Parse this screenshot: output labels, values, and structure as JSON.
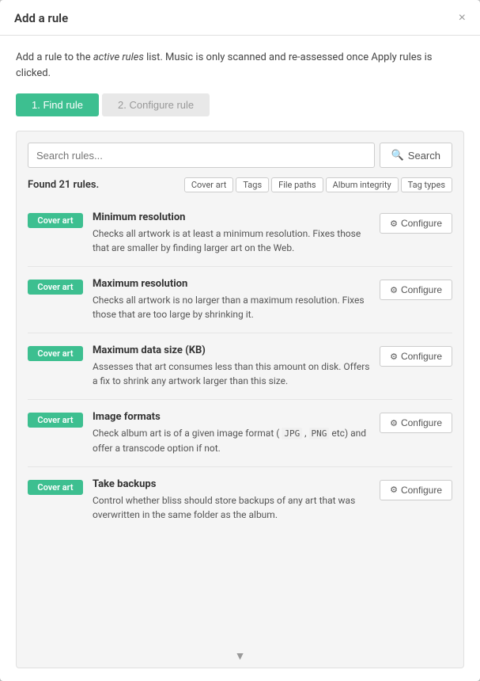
{
  "modal": {
    "title": "Add a rule",
    "close_label": "×",
    "intro": "Add a rule to the ",
    "intro_em": "active rules",
    "intro_suffix": " list. Music is only scanned and re-assessed once Apply rules is clicked.",
    "step1_label": "1. Find rule",
    "step2_label": "2. Configure rule"
  },
  "search": {
    "placeholder": "Search rules...",
    "button_label": "Search",
    "found_text": "Found 21 rules."
  },
  "filters": [
    {
      "label": "Cover art"
    },
    {
      "label": "Tags"
    },
    {
      "label": "File paths"
    },
    {
      "label": "Album integrity"
    },
    {
      "label": "Tag types"
    }
  ],
  "rules": [
    {
      "badge": "Cover art",
      "title": "Minimum resolution",
      "description": "Checks all artwork is at least a minimum resolution. Fixes those that are smaller by finding larger art on the Web.",
      "configure_label": "Configure"
    },
    {
      "badge": "Cover art",
      "title": "Maximum resolution",
      "description": "Checks all artwork is no larger than a maximum resolution. Fixes those that are too large by shrinking it.",
      "configure_label": "Configure"
    },
    {
      "badge": "Cover art",
      "title": "Maximum data size (KB)",
      "description": "Assesses that art consumes less than this amount on disk. Offers a fix to shrink any artwork larger than this size.",
      "configure_label": "Configure"
    },
    {
      "badge": "Cover art",
      "title": "Image formats",
      "description": "Check album art is of a given image format ( JPG , PNG  etc) and offer a transcode option if not.",
      "configure_label": "Configure",
      "has_code": true,
      "code_parts": [
        "JPG",
        "PNG"
      ]
    },
    {
      "badge": "Cover art",
      "title": "Take backups",
      "description": "Control whether bliss should store backups of any art that was overwritten in the same folder as the album.",
      "configure_label": "Configure"
    }
  ]
}
